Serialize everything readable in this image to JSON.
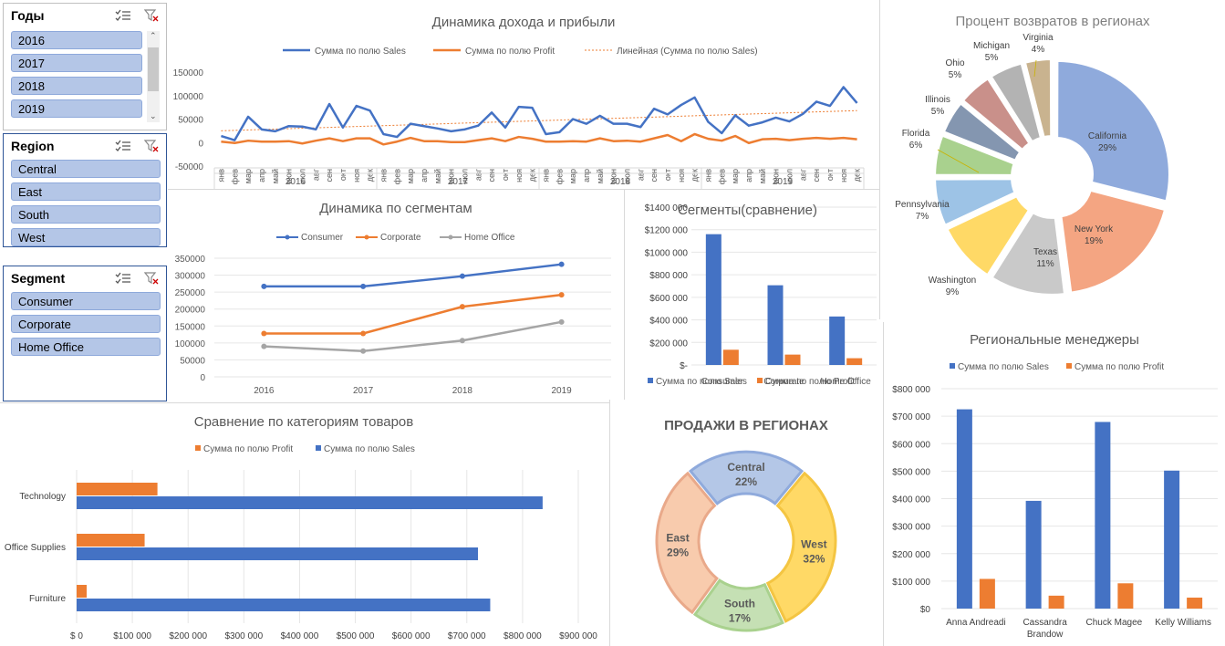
{
  "slicers": {
    "years": {
      "title": "Годы",
      "items": [
        "2016",
        "2017",
        "2018",
        "2019"
      ]
    },
    "region": {
      "title": "Region",
      "items": [
        "Central",
        "East",
        "South",
        "West"
      ]
    },
    "segment": {
      "title": "Segment",
      "items": [
        "Consumer",
        "Corporate",
        "Home Office"
      ]
    }
  },
  "colors": {
    "sales": "#4472c4",
    "profit": "#ed7d31",
    "home_office": "#a5a5a5",
    "slicer_fill": "#b4c6e7"
  },
  "chart_data": [
    {
      "id": "income",
      "type": "line",
      "title": "Динамика дохода и прибыли",
      "legend": [
        "Сумма по полю Sales",
        "Сумма по полю Profit",
        "Линейная (Сумма по полю Sales)"
      ],
      "y_ticks": [
        "150000",
        "100000",
        "50000",
        "0",
        "-50000"
      ],
      "ylim": [
        -50000,
        150000
      ],
      "months": [
        "янв",
        "фев",
        "мар",
        "апр",
        "май",
        "июн",
        "июл",
        "авг",
        "сен",
        "окт",
        "ноя",
        "дек"
      ],
      "years": [
        "2016",
        "2017",
        "2018",
        "2019"
      ],
      "series": [
        {
          "name": "Сумма по полю Sales",
          "values": [
            14000,
            5000,
            55000,
            28000,
            24000,
            35000,
            34000,
            28000,
            82000,
            32000,
            78000,
            68000,
            18000,
            12000,
            40000,
            35000,
            30000,
            24000,
            28000,
            36000,
            64000,
            32000,
            76000,
            74000,
            18000,
            22000,
            50000,
            40000,
            57000,
            40000,
            40000,
            33000,
            72000,
            60000,
            80000,
            96000,
            44000,
            20000,
            58000,
            36000,
            43000,
            53000,
            45000,
            61000,
            87000,
            78000,
            118000,
            84000
          ]
        },
        {
          "name": "Сумма по полю Profit",
          "values": [
            2000,
            -1000,
            4000,
            2000,
            2000,
            3000,
            -2000,
            4000,
            9000,
            3000,
            9000,
            9000,
            -4000,
            2000,
            10000,
            3000,
            3000,
            1000,
            1000,
            5000,
            9000,
            3000,
            12000,
            8000,
            2000,
            2000,
            3000,
            2000,
            9000,
            3000,
            4000,
            2000,
            9000,
            16000,
            3000,
            18000,
            8000,
            4000,
            14000,
            -1000,
            7000,
            8000,
            5000,
            8000,
            10000,
            8000,
            10000,
            7000
          ]
        }
      ],
      "trend": [
        25000,
        68000
      ]
    },
    {
      "id": "segments_line",
      "type": "line",
      "title": "Динамика по сегментам",
      "categories": [
        "2016",
        "2017",
        "2018",
        "2019"
      ],
      "y_ticks": [
        "350000",
        "300000",
        "250000",
        "200000",
        "150000",
        "100000",
        "50000",
        "0"
      ],
      "ylim": [
        0,
        350000
      ],
      "series": [
        {
          "name": "Consumer",
          "values": [
            267000,
            267000,
            297000,
            332000
          ]
        },
        {
          "name": "Corporate",
          "values": [
            128000,
            128000,
            207000,
            242000
          ]
        },
        {
          "name": "Home Office",
          "values": [
            90000,
            76000,
            107000,
            162000
          ]
        }
      ]
    },
    {
      "id": "segments_bar",
      "type": "bar",
      "title": "Сегменты(сравнение)",
      "categories": [
        "Consumer",
        "Corporate",
        "Home Office"
      ],
      "y_ticks": [
        "$1400 000",
        "$1200 000",
        "$1000 000",
        "$800 000",
        "$600 000",
        "$400 000",
        "$200 000",
        "$-"
      ],
      "ylim": [
        0,
        1400000
      ],
      "series": [
        {
          "name": "Сумма по полю Sales",
          "values": [
            1160000,
            707000,
            430000
          ]
        },
        {
          "name": "Сумма по полю Profit",
          "values": [
            135000,
            92000,
            60000
          ]
        }
      ]
    },
    {
      "id": "returns_pie",
      "type": "pie",
      "title": "Процент возвратов в регионах",
      "slices": [
        {
          "label": "California",
          "pct": "29%",
          "value": 29,
          "color": "#8faadc"
        },
        {
          "label": "New York",
          "pct": "19%",
          "value": 19,
          "color": "#f4a582"
        },
        {
          "label": "Texas",
          "pct": "11%",
          "value": 11,
          "color": "#c9c9c9"
        },
        {
          "label": "Washington",
          "pct": "9%",
          "value": 9,
          "color": "#ffd966"
        },
        {
          "label": "Pennsylvania",
          "pct": "7%",
          "value": 7,
          "color": "#9dc3e6"
        },
        {
          "label": "Florida",
          "pct": "6%",
          "value": 6,
          "color": "#a9d18e"
        },
        {
          "label": "Illinois",
          "pct": "5%",
          "value": 5,
          "color": "#8496b0"
        },
        {
          "label": "Ohio",
          "pct": "5%",
          "value": 5,
          "color": "#c9908a"
        },
        {
          "label": "Michigan",
          "pct": "5%",
          "value": 5,
          "color": "#b3b3b3"
        },
        {
          "label": "Virginia",
          "pct": "4%",
          "value": 4,
          "color": "#c9b38f"
        }
      ]
    },
    {
      "id": "managers",
      "type": "bar",
      "title": "Региональные менеджеры",
      "categories": [
        "Anna Andreadi",
        "Cassandra Brandow",
        "Chuck Magee",
        "Kelly Williams"
      ],
      "y_ticks": [
        "$800 000",
        "$700 000",
        "$600 000",
        "$500 000",
        "$400 000",
        "$300 000",
        "$200 000",
        "$100 000",
        "$0"
      ],
      "ylim": [
        0,
        800000
      ],
      "series": [
        {
          "name": "Сумма по полю Sales",
          "values": [
            725000,
            392000,
            679000,
            502000
          ]
        },
        {
          "name": "Сумма по полю Profit",
          "values": [
            108000,
            47000,
            92000,
            40000
          ]
        }
      ]
    },
    {
      "id": "categories",
      "type": "bar",
      "title": "Сравнение по категориям товаров",
      "categories": [
        "Technology",
        "Office Supplies",
        "Furniture"
      ],
      "x_ticks": [
        "$ 0",
        "$100 000",
        "$200 000",
        "$300 000",
        "$400 000",
        "$500 000",
        "$600 000",
        "$700 000",
        "$800 000",
        "$900 000"
      ],
      "xlim": [
        0,
        900000
      ],
      "legend": [
        "Сумма по полю Profit",
        "Сумма по полю Sales"
      ],
      "series": [
        {
          "name": "Сумма по полю Sales",
          "values": [
            836000,
            720000,
            742000
          ]
        },
        {
          "name": "Сумма по полю Profit",
          "values": [
            145000,
            122000,
            18000
          ]
        }
      ]
    },
    {
      "id": "regions_donut",
      "type": "pie",
      "title": "ПРОДАЖИ В РЕГИОНАХ",
      "slices": [
        {
          "label": "Central",
          "pct": "22%",
          "value": 22,
          "color": "#b4c7e7",
          "stroke": "#8faadc"
        },
        {
          "label": "West",
          "pct": "32%",
          "value": 32,
          "color": "#ffd966",
          "stroke": "#f4c542"
        },
        {
          "label": "South",
          "pct": "17%",
          "value": 17,
          "color": "#c5e0b4",
          "stroke": "#a9d18e"
        },
        {
          "label": "East",
          "pct": "29%",
          "value": 29,
          "color": "#f8cbad",
          "stroke": "#e9a98a"
        }
      ]
    }
  ]
}
